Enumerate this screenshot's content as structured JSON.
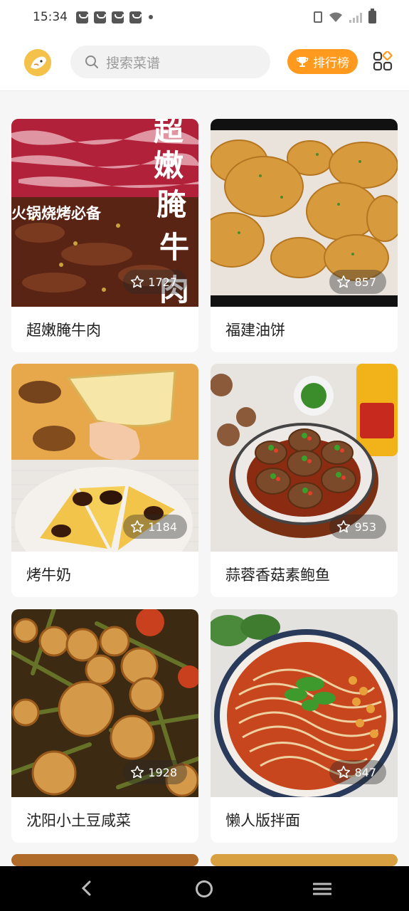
{
  "status_bar": {
    "time": "15:34"
  },
  "header": {
    "search_placeholder": "搜索菜谱",
    "rank_label": "排行榜"
  },
  "recipes": [
    {
      "title": "超嫩腌牛肉",
      "rating": "1727"
    },
    {
      "title": "福建油饼",
      "rating": "857"
    },
    {
      "title": "烤牛奶",
      "rating": "1184"
    },
    {
      "title": "蒜蓉香菇素鲍鱼",
      "rating": "953"
    },
    {
      "title": "沈阳小土豆咸菜",
      "rating": "1928"
    },
    {
      "title": "懒人版拌面",
      "rating": "847"
    }
  ],
  "photo_overlay_text": {
    "beef_title": "超嫩腌牛肉",
    "beef_sub": "火锅烧烤必备"
  },
  "colors": {
    "accent": "#ff9a1f",
    "avatar": "#f4c24a",
    "background": "#f6f6f6"
  },
  "icons": {
    "search": "search-icon",
    "trophy": "trophy-icon",
    "apps": "apps-grid-icon",
    "star": "star-icon"
  }
}
